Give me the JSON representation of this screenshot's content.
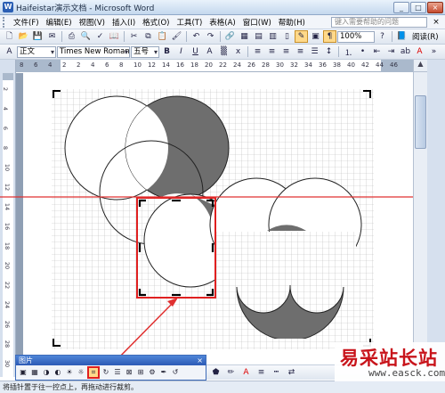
{
  "window": {
    "title": "Haifeistar演示文档 - Microsoft Word",
    "minimize": "_",
    "maximize": "□",
    "close": "×"
  },
  "menubar": {
    "items": [
      {
        "label": "文件(F)"
      },
      {
        "label": "编辑(E)"
      },
      {
        "label": "视图(V)"
      },
      {
        "label": "插入(I)"
      },
      {
        "label": "格式(O)"
      },
      {
        "label": "工具(T)"
      },
      {
        "label": "表格(A)"
      },
      {
        "label": "窗口(W)"
      },
      {
        "label": "帮助(H)"
      }
    ],
    "help_placeholder": "键入需要帮助的问题",
    "close_doc": "×"
  },
  "toolbar_standard": {
    "zoom": "100%",
    "reading_button": "阅读(R)"
  },
  "toolbar_format": {
    "style": "正文",
    "font": "Times New Roman",
    "size": "五号",
    "bold": "B",
    "italic": "I",
    "underline": "U"
  },
  "ruler": {
    "h_numbers": [
      "8",
      "6",
      "4",
      "2",
      "2",
      "4",
      "6",
      "8",
      "10",
      "12",
      "14",
      "16",
      "18",
      "20",
      "22",
      "24",
      "26",
      "28",
      "30",
      "32",
      "34",
      "36",
      "38",
      "40",
      "42",
      "44",
      "46"
    ],
    "v_numbers": [
      "2",
      "4",
      "6",
      "8",
      "10",
      "12",
      "14",
      "16",
      "18",
      "20",
      "22",
      "24",
      "26",
      "28",
      "30"
    ]
  },
  "picture_toolbar": {
    "title": "图片",
    "close": "×"
  },
  "status": {
    "text": "将插针置于往一控点上，再拖动进行裁剪。"
  },
  "watermark": {
    "chinese": "易采站长站",
    "url": "www.easck.com"
  },
  "colors": {
    "selection_red": "#e02020",
    "gray_fill": "#6e6e6e",
    "guide_line": "#e03030"
  }
}
